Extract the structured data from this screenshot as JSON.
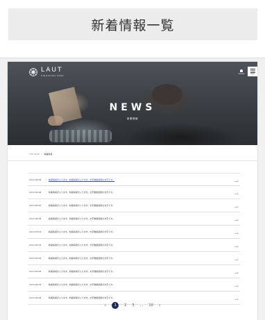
{
  "page_title": "新着情報一覧",
  "site": {
    "logo_text": "LAUT",
    "logo_sub": "HIROSHIMA PARK",
    "header_buttons": [
      {
        "icon": "reserve-icon",
        "label": "RESERVE"
      },
      {
        "icon": "menu-icon",
        "label": "MENU"
      }
    ]
  },
  "hero": {
    "title": "NEWS",
    "subtitle": "新着情報"
  },
  "breadcrumb": {
    "home": "TOP PAGE",
    "separator": ">",
    "current": "新着情報"
  },
  "news": [
    {
      "date": "2019.08.08",
      "text": "新着情報が入ります。新着情報が入ります。文字数確認用の文字です。"
    },
    {
      "date": "2019.08.08",
      "text": "新着情報が入ります。新着情報が入ります。文字数確認用の文字です。"
    },
    {
      "date": "2019.08.08",
      "text": "新着情報が入ります。新着情報が入ります。文字数確認用の文字です。"
    },
    {
      "date": "2019.08.08",
      "text": "新着情報が入ります。新着情報が入ります。文字数確認用の文字です。"
    },
    {
      "date": "2019.08.08",
      "text": "新着情報が入ります。新着情報が入ります。文字数確認用の文字です。"
    },
    {
      "date": "2019.08.08",
      "text": "新着情報が入ります。新着情報が入ります。文字数確認用の文字です。"
    },
    {
      "date": "2019.08.08",
      "text": "新着情報が入ります。新着情報が入ります。文字数確認用の文字です。"
    },
    {
      "date": "2019.08.08",
      "text": "新着情報が入ります。新着情報が入ります。文字数確認用の文字です。"
    },
    {
      "date": "2019.08.08",
      "text": "新着情報が入ります。新着情報が入ります。文字数確認用の文字です。"
    },
    {
      "date": "2019.08.08",
      "text": "新着情報が入ります。新着情報が入ります。文字数確認用の文字です。"
    }
  ],
  "pagination": {
    "prev": "‹",
    "pages": [
      "1",
      "2",
      "3"
    ],
    "ellipsis": "...",
    "last": "10",
    "next": "›",
    "current": "1"
  },
  "colors": {
    "accent": "#1e2a55",
    "link": "#3a4fa8",
    "title_bg": "#ececec"
  }
}
